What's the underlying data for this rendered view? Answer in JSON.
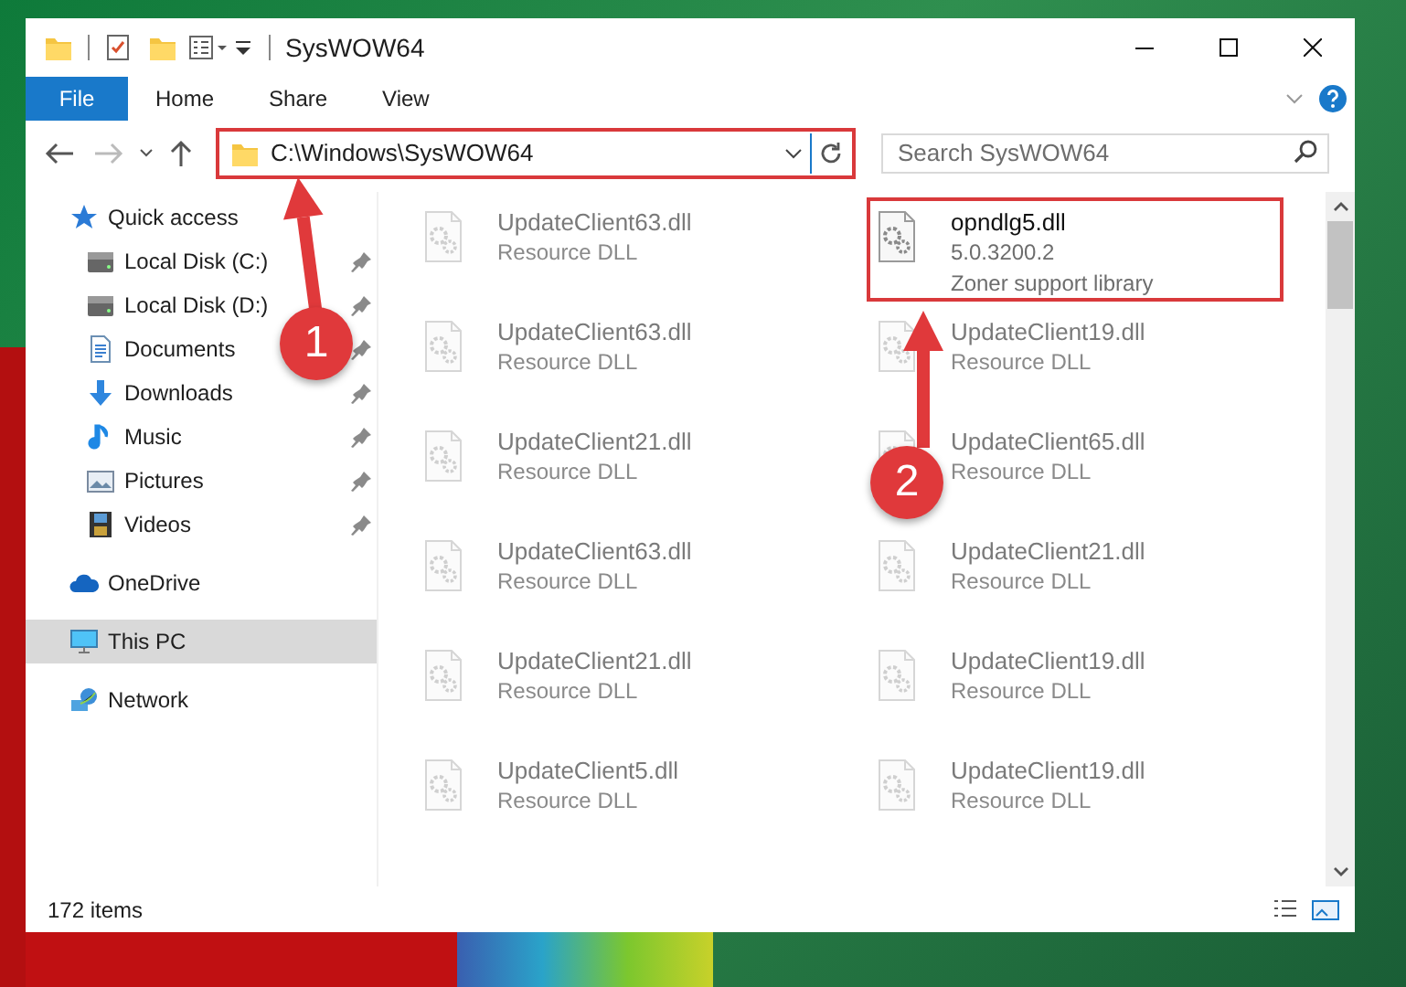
{
  "window": {
    "title": "SysWOW64"
  },
  "ribbon_tabs": [
    {
      "label": "File",
      "kind": "file"
    },
    {
      "label": "Home",
      "kind": "tab"
    },
    {
      "label": "Share",
      "kind": "tab"
    },
    {
      "label": "View",
      "kind": "tab"
    }
  ],
  "address_bar": {
    "path": "C:\\Windows\\SysWOW64",
    "highlighted": true
  },
  "search": {
    "placeholder": "Search SysWOW64"
  },
  "sidebar": {
    "items": [
      {
        "label": "Quick access",
        "kind": "star",
        "selected": false,
        "children": [
          {
            "label": "Local Disk (C:)",
            "kind": "drive",
            "selected": false,
            "pinned": true
          },
          {
            "label": "Local Disk (D:)",
            "kind": "drive",
            "selected": false,
            "pinned": true
          },
          {
            "label": "Documents",
            "kind": "documents",
            "selected": false,
            "pinned": true
          },
          {
            "label": "Downloads",
            "kind": "downloads",
            "selected": false,
            "pinned": true
          },
          {
            "label": "Music",
            "kind": "music",
            "selected": false,
            "pinned": true
          },
          {
            "label": "Pictures",
            "kind": "pictures",
            "selected": false,
            "pinned": true
          },
          {
            "label": "Videos",
            "kind": "videos",
            "selected": false,
            "pinned": true
          }
        ]
      },
      {
        "label": "OneDrive",
        "kind": "cloud",
        "selected": false
      },
      {
        "label": "This PC",
        "kind": "pc",
        "selected": true
      },
      {
        "label": "Network",
        "kind": "network",
        "selected": false
      }
    ]
  },
  "files": [
    {
      "name": "UpdateClient63.dll",
      "lines": [
        "Resource DLL"
      ],
      "dimmed": true,
      "highlighted": false
    },
    {
      "name": "opndlg5.dll",
      "lines": [
        "5.0.3200.2",
        "Zoner support library"
      ],
      "dimmed": false,
      "highlighted": true
    },
    {
      "name": "UpdateClient63.dll",
      "lines": [
        "Resource DLL"
      ],
      "dimmed": true,
      "highlighted": false
    },
    {
      "name": "UpdateClient19.dll",
      "lines": [
        "Resource DLL"
      ],
      "dimmed": true,
      "highlighted": false
    },
    {
      "name": "UpdateClient21.dll",
      "lines": [
        "Resource DLL"
      ],
      "dimmed": true,
      "highlighted": false
    },
    {
      "name": "UpdateClient65.dll",
      "lines": [
        "Resource DLL"
      ],
      "dimmed": true,
      "highlighted": false
    },
    {
      "name": "UpdateClient63.dll",
      "lines": [
        "Resource DLL"
      ],
      "dimmed": true,
      "highlighted": false
    },
    {
      "name": "UpdateClient21.dll",
      "lines": [
        "Resource DLL"
      ],
      "dimmed": true,
      "highlighted": false
    },
    {
      "name": "UpdateClient21.dll",
      "lines": [
        "Resource DLL"
      ],
      "dimmed": true,
      "highlighted": false
    },
    {
      "name": "UpdateClient19.dll",
      "lines": [
        "Resource DLL"
      ],
      "dimmed": true,
      "highlighted": false
    },
    {
      "name": "UpdateClient5.dll",
      "lines": [
        "Resource DLL"
      ],
      "dimmed": true,
      "highlighted": false
    },
    {
      "name": "UpdateClient19.dll",
      "lines": [
        "Resource DLL"
      ],
      "dimmed": true,
      "highlighted": false
    }
  ],
  "status_bar": {
    "count": "172 items"
  },
  "annotations": [
    {
      "number": "1"
    },
    {
      "number": "2"
    }
  ]
}
